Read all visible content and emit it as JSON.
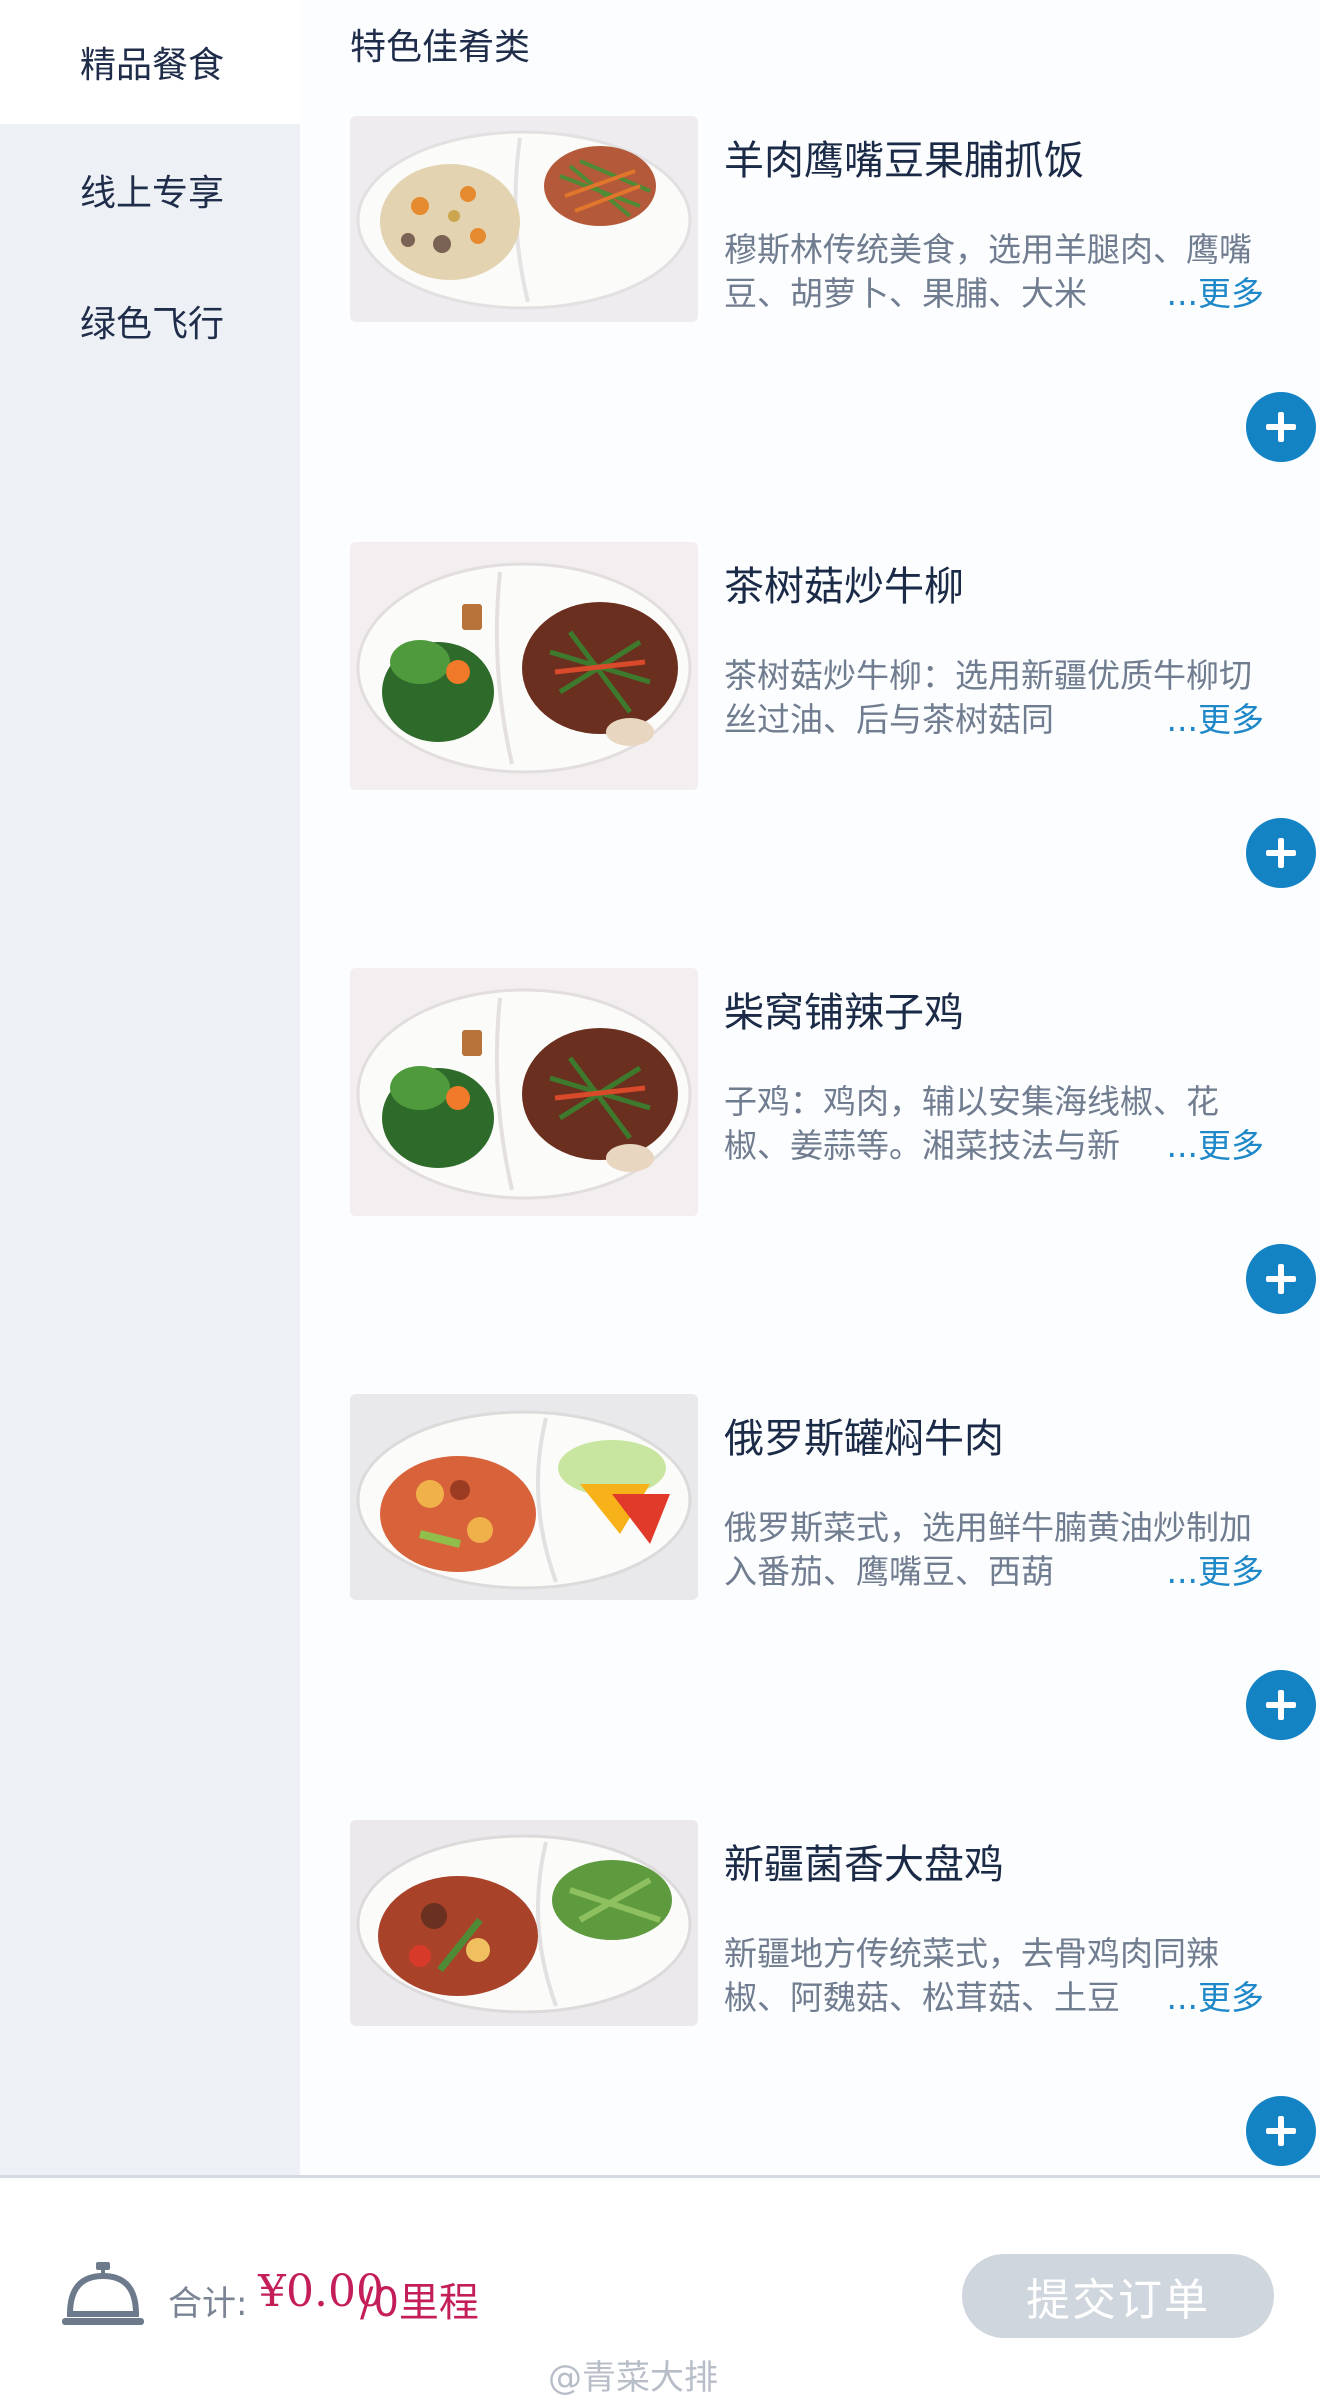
{
  "sidebar": {
    "items": [
      {
        "label": "精品餐食",
        "active": true
      },
      {
        "label": "线上专享",
        "active": false
      },
      {
        "label": "绿色飞行",
        "active": false
      }
    ]
  },
  "main": {
    "section_title": "特色佳肴类",
    "more_label": "...更多",
    "dishes": [
      {
        "name": "羊肉鹰嘴豆果脯抓饭",
        "description": "穆斯林传统美食，选用羊腿肉、鹰嘴豆、胡萝卜、果脯、大米",
        "photo": "pilaf-plate"
      },
      {
        "name": "茶树菇炒牛柳",
        "description": "茶树菇炒牛柳：选用新疆优质牛柳切丝过油、后与茶树菇同",
        "photo": "beef-greens-plate"
      },
      {
        "name": "柴窝铺辣子鸡",
        "description": "子鸡：鸡肉，辅以安集海线椒、花椒、姜蒜等。湘菜技法与新",
        "photo": "beef-greens-plate"
      },
      {
        "name": "俄罗斯罐焖牛肉",
        "description": "俄罗斯菜式，选用鲜牛腩黄油炒制加入番茄、鹰嘴豆、西葫",
        "photo": "stew-salad-plate"
      },
      {
        "name": "新疆菌香大盘鸡",
        "description": "新疆地方传统菜式，去骨鸡肉同辣椒、阿魏菇、松茸菇、土豆",
        "photo": "chicken-veg-plate"
      }
    ]
  },
  "footer": {
    "total_label": "合计:",
    "total_amount": "¥0.00",
    "total_miles": "/0里程",
    "submit_label": "提交订单",
    "watermark": "@青菜大排"
  },
  "colors": {
    "accent_blue": "#1383c4",
    "price_red": "#c41e5a",
    "sidebar_bg": "#edf0f5",
    "submit_disabled": "#d0d6de"
  },
  "icons": [
    "bell-icon",
    "plus-icon"
  ]
}
